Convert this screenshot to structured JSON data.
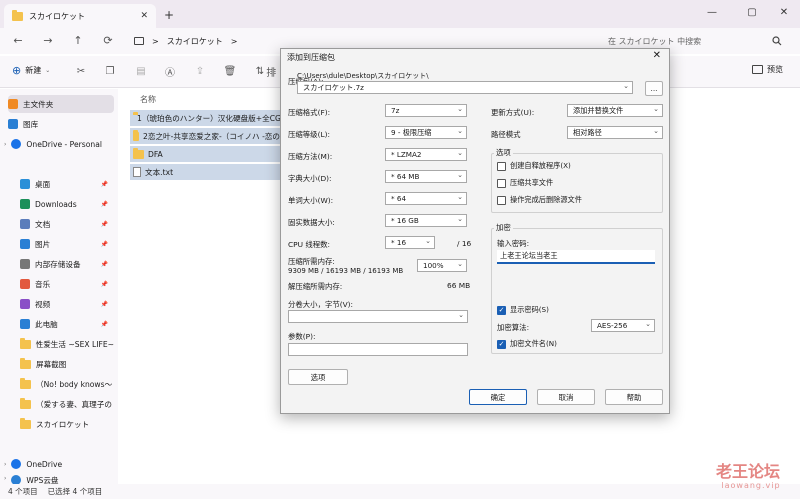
{
  "explorer": {
    "tab_title": "スカイロケット",
    "tab_close": "✕",
    "tab_add": "+",
    "window_controls": [
      "—",
      "▢",
      "✕"
    ],
    "nav": [
      "←",
      "→",
      "↑",
      "⟳"
    ],
    "breadcrumb_sep": ">",
    "breadcrumb": "スカイロケット",
    "breadcrumb_more": ">",
    "search_placeholder": "在 スカイロケット 中搜索",
    "toolbar": {
      "new_label": "新建",
      "sort_label": "排",
      "preview_label": "预览"
    },
    "sidebar": [
      {
        "label": "主文件夹",
        "icon": "home-icon",
        "color": "#f08a24"
      },
      {
        "label": "图库",
        "icon": "gallery-icon",
        "color": "#2a7fd4"
      },
      {
        "label": "OneDrive - Personal",
        "icon": "cloud-icon",
        "color": "#1a73e8"
      },
      {
        "label": "桌面",
        "icon": "desktop-icon",
        "color": "#2a8fd8"
      },
      {
        "label": "Downloads",
        "icon": "download-icon",
        "color": "#1b8f5a"
      },
      {
        "label": "文档",
        "icon": "document-icon",
        "color": "#5b7dbb"
      },
      {
        "label": "图片",
        "icon": "picture-icon",
        "color": "#2a7fd4"
      },
      {
        "label": "内部存储设备",
        "icon": "drive-icon",
        "color": "#777777"
      },
      {
        "label": "音乐",
        "icon": "music-icon",
        "color": "#e2583e"
      },
      {
        "label": "视频",
        "icon": "video-icon",
        "color": "#8a4fc7"
      },
      {
        "label": "此电脑",
        "icon": "computer-icon",
        "color": "#2a7fd4"
      },
      {
        "label": "性爱生活 ~SEX LIFE~",
        "icon": "folder-icon",
        "color": "#f4c24d"
      },
      {
        "label": "屏幕截图",
        "icon": "folder-icon",
        "color": "#f4c24d"
      },
      {
        "label": "（No! body knows～",
        "icon": "folder-icon",
        "color": "#f4c24d"
      },
      {
        "label": "（爱する妻、真理子の",
        "icon": "folder-icon",
        "color": "#f4c24d"
      },
      {
        "label": "スカイロケット",
        "icon": "folder-icon",
        "color": "#f4c24d"
      },
      {
        "label": "OneDrive",
        "icon": "cloud-icon",
        "color": "#1a73e8"
      },
      {
        "label": "WPS云盘",
        "icon": "cloud-icon",
        "color": "#2a7fd4"
      }
    ],
    "column_name": "名称",
    "files": [
      {
        "name": "1（琥珀色のハンター）汉化硬盘版+全CG",
        "type": "folder"
      },
      {
        "name": "2恋之叶-共享恋爱之家-（コイノハ -恋の",
        "type": "folder"
      },
      {
        "name": "DFA",
        "type": "folder"
      },
      {
        "name": "文本.txt",
        "type": "txt"
      }
    ],
    "status": {
      "count": "4 个项目",
      "selected": "已选择 4 个项目"
    }
  },
  "watermark": {
    "text": "老王论坛",
    "sub": "laowang.vip"
  },
  "dialog": {
    "title": "添加到压缩包",
    "close": "✕",
    "archive_label": "压缩包(A):",
    "archive_path": "C:\\Users\\dule\\Desktop\\スカイロケット\\",
    "archive_name": "スカイロケット.7z",
    "browse": "...",
    "left_fields": [
      {
        "label": "压缩格式(F):",
        "value": "7z"
      },
      {
        "label": "压缩等级(L):",
        "value": "9 - 极限压缩"
      },
      {
        "label": "压缩方法(M):",
        "value": "* LZMA2"
      },
      {
        "label": "字典大小(D):",
        "value": "* 64 MB"
      },
      {
        "label": "单词大小(W):",
        "value": "* 64"
      },
      {
        "label": "固实数据大小:",
        "value": "* 16 GB"
      }
    ],
    "cpu_label": "CPU 线程数:",
    "cpu_value": "* 16",
    "cpu_max": "/ 16",
    "mem_label": "压缩所需内存:",
    "mem_detail": "9309 MB / 16193 MB / 16193 MB",
    "mem_pct": "100%",
    "decomp_label": "解压缩所需内存:",
    "decomp_value": "66 MB",
    "split_label": "分卷大小，字节(V):",
    "params_label": "参数(P):",
    "options_button": "选项",
    "update_label": "更新方式(U):",
    "update_value": "添加并替换文件",
    "path_label": "路径模式",
    "path_value": "相对路径",
    "options_title": "选项",
    "options": [
      {
        "label": "创建自释放程序(X)",
        "checked": false
      },
      {
        "label": "压缩共享文件",
        "checked": false
      },
      {
        "label": "操作完成后删除源文件",
        "checked": false
      }
    ],
    "encrypt_title": "加密",
    "password_label": "输入密码:",
    "password_value": "上老王论坛当老王",
    "show_password": {
      "label": "显示密码(S)",
      "checked": true
    },
    "encrypt_method_label": "加密算法:",
    "encrypt_method_value": "AES-256",
    "encrypt_names": {
      "label": "加密文件名(N)",
      "checked": true
    },
    "ok": "确定",
    "cancel": "取消",
    "help": "帮助"
  }
}
